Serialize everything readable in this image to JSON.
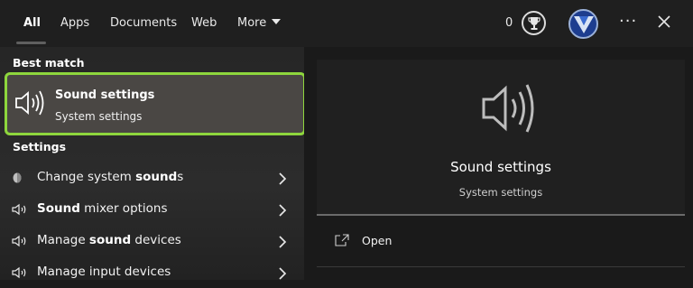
{
  "tabs": {
    "all": "All",
    "apps": "Apps",
    "documents": "Documents",
    "web": "Web",
    "more": "More"
  },
  "header": {
    "points": "0",
    "ellipsis": "···"
  },
  "left": {
    "best_match_label": "Best match",
    "best_match": {
      "title": "Sound settings",
      "subtitle": "System settings",
      "icon": "speaker-icon"
    },
    "settings_label": "Settings",
    "items": [
      {
        "pre": "Change system ",
        "bold": "sound",
        "post": "s",
        "icon": "sound-theme-icon"
      },
      {
        "pre": "",
        "bold": "Sound",
        "post": " mixer options",
        "icon": "speaker-icon"
      },
      {
        "pre": "Manage ",
        "bold": "sound",
        "post": " devices",
        "icon": "speaker-icon"
      },
      {
        "pre": "Manage input devices",
        "bold": "",
        "post": "",
        "icon": "speaker-icon"
      }
    ]
  },
  "right": {
    "title": "Sound settings",
    "subtitle": "System settings",
    "open_label": "Open"
  },
  "colors": {
    "highlight_border": "#8ed63d",
    "selected_bg": "#4a4744"
  }
}
